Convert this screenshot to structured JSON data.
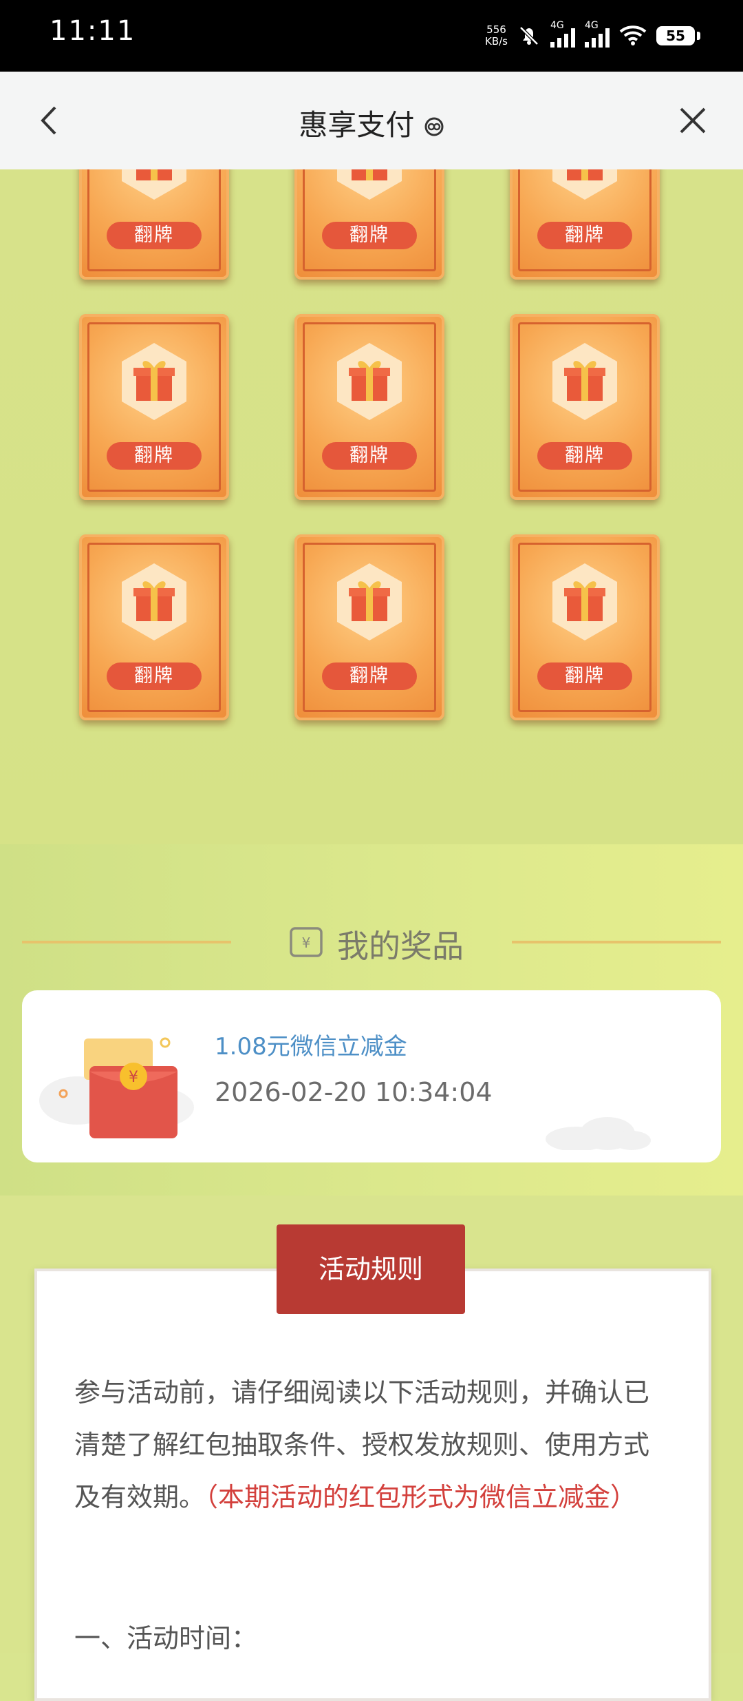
{
  "status_bar": {
    "time": "11:11",
    "net_speed_value": "556",
    "net_speed_unit": "KB/s",
    "sim1_label": "4G",
    "sim2_label": "4G",
    "battery": "55"
  },
  "nav": {
    "title": "惠享支付",
    "back_icon": "chevron-left-icon",
    "close_icon": "close-icon"
  },
  "cards": {
    "flip_label": "翻牌",
    "rows": 3,
    "cols": 3
  },
  "prizes": {
    "heading": "我的奖品",
    "items": [
      {
        "name": "1.08元微信立减金",
        "time": "2026-02-20 10:34:04"
      }
    ]
  },
  "rules": {
    "button_label": "活动规则",
    "intro": "参与活动前，请仔细阅读以下活动规则，并确认已清楚了解红包抽取条件、授权发放规则、使用方式及有效期。",
    "intro_highlight": "（本期活动的红包形式为微信立减金）",
    "item_1": "一、活动时间："
  },
  "colors": {
    "background": "#d9e58f",
    "card_orange": "#f7a752",
    "flip_button": "#e5573b",
    "rules_button": "#b83a33",
    "prize_name": "#4d8fc6",
    "highlight_red": "#d3403c"
  }
}
